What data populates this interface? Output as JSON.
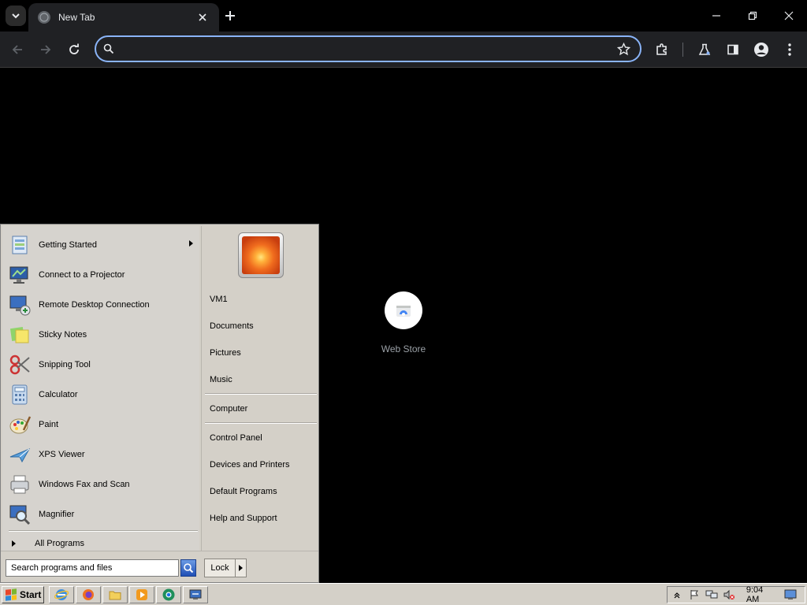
{
  "browser": {
    "tab": {
      "title": "New Tab"
    },
    "omnibox": {
      "value": "",
      "placeholder": ""
    }
  },
  "newtab": {
    "shortcuts": [
      {
        "label": "Web Store"
      }
    ]
  },
  "startmenu": {
    "programs": [
      {
        "label": "Getting Started",
        "icon": "getting-started-icon",
        "has_submenu": true
      },
      {
        "label": "Connect to a Projector",
        "icon": "projector-icon"
      },
      {
        "label": "Remote Desktop Connection",
        "icon": "remote-desktop-icon"
      },
      {
        "label": "Sticky Notes",
        "icon": "sticky-notes-icon"
      },
      {
        "label": "Snipping Tool",
        "icon": "snipping-tool-icon"
      },
      {
        "label": "Calculator",
        "icon": "calculator-icon"
      },
      {
        "label": "Paint",
        "icon": "paint-icon"
      },
      {
        "label": "XPS Viewer",
        "icon": "xps-viewer-icon"
      },
      {
        "label": "Windows Fax and Scan",
        "icon": "fax-scan-icon"
      },
      {
        "label": "Magnifier",
        "icon": "magnifier-icon"
      }
    ],
    "all_programs": "All Programs",
    "places_group1": [
      "VM1",
      "Documents",
      "Pictures",
      "Music"
    ],
    "places_group2": [
      "Computer"
    ],
    "places_group3": [
      "Control Panel",
      "Devices and Printers",
      "Default Programs",
      "Help and Support"
    ],
    "search": {
      "value": "Search programs and files"
    },
    "lock_label": "Lock"
  },
  "taskbar": {
    "start_label": "Start",
    "quicklaunch": [
      "internet-explorer-icon",
      "firefox-icon",
      "folder-icon",
      "media-player-icon",
      "chrome-icon",
      "remote-icon"
    ],
    "tray_icons": [
      "show-hidden-icon",
      "action-center-icon",
      "network-icon",
      "volume-muted-icon"
    ],
    "clock": "9:04 AM"
  },
  "colors": {
    "accent": "#8ab4f8",
    "chrome_bg": "#202124",
    "menu_bg": "#d4d0c8"
  }
}
